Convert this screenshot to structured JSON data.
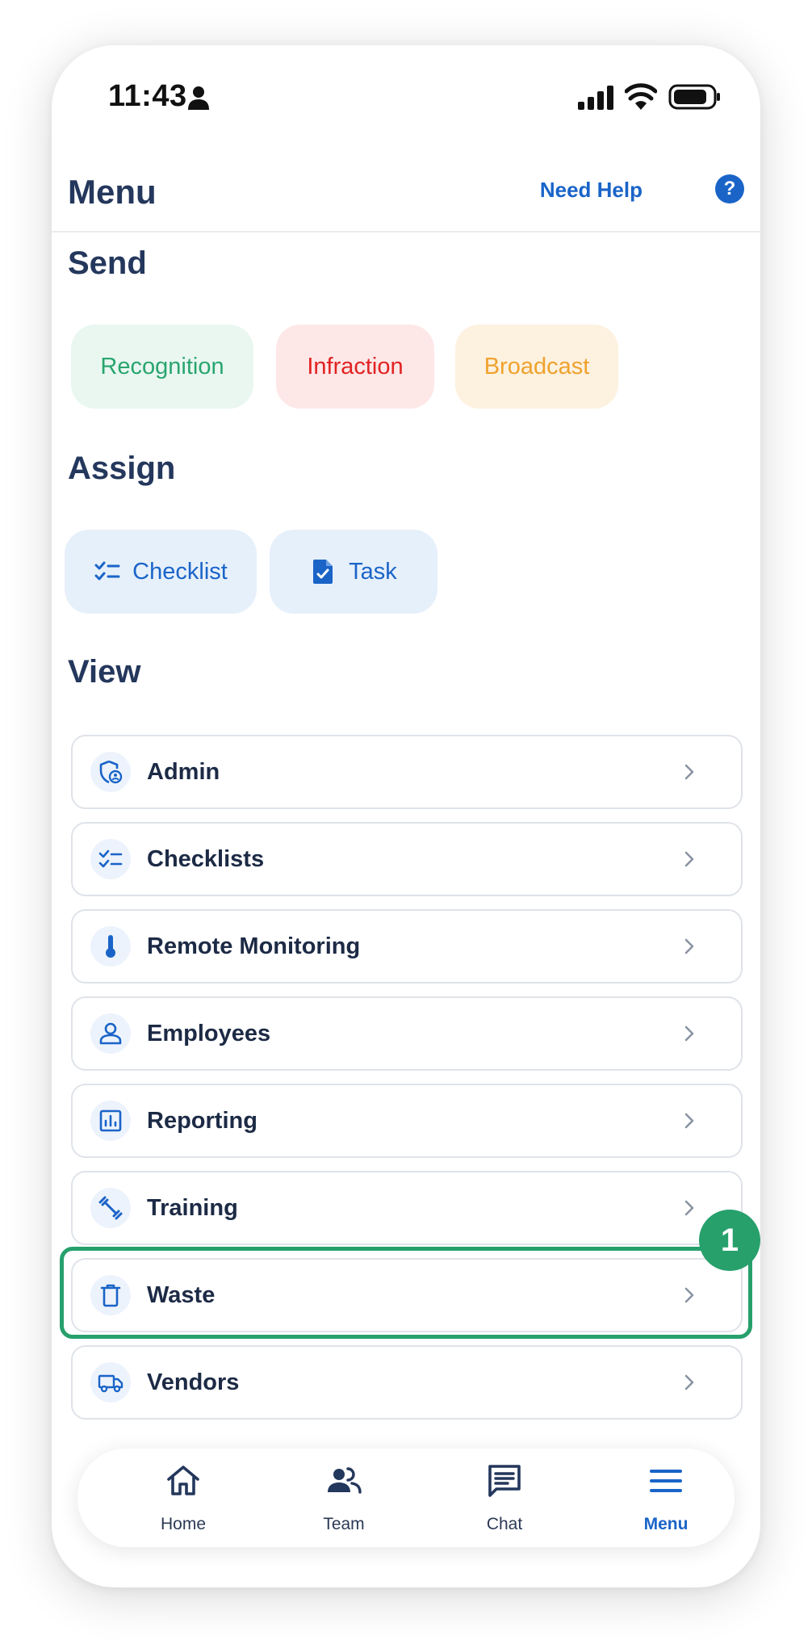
{
  "status_bar": {
    "time": "11:43"
  },
  "header": {
    "title": "Menu",
    "help_label": "Need Help",
    "help_badge": "?"
  },
  "send": {
    "title": "Send",
    "buttons": [
      {
        "label": "Recognition",
        "color": "#29a56f"
      },
      {
        "label": "Infraction",
        "color": "#e22222"
      },
      {
        "label": "Broadcast",
        "color": "#efa22d"
      }
    ]
  },
  "assign": {
    "title": "Assign",
    "buttons": [
      {
        "label": "Checklist",
        "icon": "checklist-icon"
      },
      {
        "label": "Task",
        "icon": "task-document-icon"
      }
    ]
  },
  "view": {
    "title": "View",
    "items": [
      {
        "label": "Admin",
        "icon": "admin-shield-icon"
      },
      {
        "label": "Checklists",
        "icon": "checklist-icon"
      },
      {
        "label": "Remote Monitoring",
        "icon": "thermometer-icon"
      },
      {
        "label": "Employees",
        "icon": "person-icon"
      },
      {
        "label": "Reporting",
        "icon": "report-chart-icon"
      },
      {
        "label": "Training",
        "icon": "dumbbell-icon"
      },
      {
        "label": "Waste",
        "icon": "trash-icon"
      },
      {
        "label": "Vendors",
        "icon": "truck-icon"
      }
    ]
  },
  "callout": {
    "number": "1",
    "color": "#27a06c"
  },
  "bottom_nav": {
    "tabs": [
      {
        "label": "Home",
        "icon": "home-icon"
      },
      {
        "label": "Team",
        "icon": "team-icon"
      },
      {
        "label": "Chat",
        "icon": "chat-icon"
      },
      {
        "label": "Menu",
        "icon": "menu-icon",
        "active": true
      }
    ]
  },
  "colors": {
    "accent": "#1a64c8",
    "heading": "#24375c",
    "highlight": "#27a06c"
  }
}
